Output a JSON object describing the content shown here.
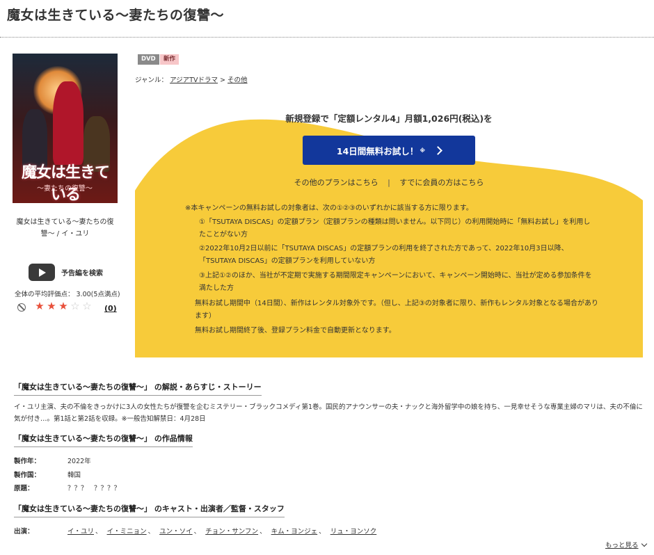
{
  "page": {
    "title": "魔女は生きている〜妻たちの復讐〜"
  },
  "product": {
    "poster_title": "魔女は生きている",
    "poster_subtitle": "〜妻たちの復讐〜",
    "caption": "魔女は生きている〜妻たちの復讐〜 / イ・ユリ",
    "trailer_label": "予告編を検索",
    "average_rating_text": "全体の平均評価点： 3.00(5点満点)",
    "rating": 3,
    "rating_max": 5,
    "review_count": "(0)",
    "badges": {
      "dvd": "DVD",
      "new": "新作"
    },
    "genre": {
      "label": "ジャンル：",
      "link1": "アジアTVドラマ",
      "separator": ">",
      "link2": "その他"
    }
  },
  "campaign": {
    "headline": "新規登録で「定額レンタル4」月額1,026円(税込)を",
    "cta_label": "14日間無料お試し！",
    "cta_note": "※",
    "other_plans": "その他のプランはこちら",
    "divider": "|",
    "members": "すでに会員の方はこちら",
    "conditions_head": "※本キャンペーンの無料お試しの対象者は、次の①②③のいずれかに該当する方に限ります。",
    "conditions": [
      "①「TSUTAYA DISCAS」の定額プラン（定額プランの種類は問いません。以下同じ）の利用開始時に「無料お試し」を利用したことがない方",
      "②2022年10月2日以前に「TSUTAYA DISCAS」の定額プランの利用を終了された方であって、2022年10月3日以降、「TSUTAYA DISCAS」の定額プランを利用していない方",
      "③上記①②のほか、当社が不定期で実施する期間限定キャンペーンにおいて、キャンペーン開始時に、当社が定める参加条件を満たした方"
    ],
    "notes": [
      "無料お試し期間中（14日間）、新作はレンタル対象外です。（但し、上記③の対象者に限り、新作もレンタル対象となる場合があります）",
      "無料お試し期間終了後、登録プラン料金で自動更新となります。"
    ]
  },
  "sections": {
    "synopsis_head": "「魔女は生きている〜妻たちの復讐〜」 の解説・あらすじ・ストーリー",
    "synopsis_text": "イ・ユリ主演、夫の不倫をきっかけに3人の女性たちが復讐を企むミステリー・ブラックコメディ第1巻。国民的アナウンサーの夫・ナックと海外留学中の娘を持ち、一見幸せそうな専業主婦のマリは、夫の不倫に気が付き…。第1話と第2話を収録。※一般告知解禁日：4月28日",
    "info_head": "「魔女は生きている〜妻たちの復讐〜」 の作品情報",
    "info": [
      {
        "label": "製作年：",
        "value": "2022年"
      },
      {
        "label": "製作国：",
        "value": "韓国"
      },
      {
        "label": "原題：",
        "value": "？？？　？？？？"
      }
    ],
    "cast_head": "「魔女は生きている〜妻たちの復讐〜」 のキャスト・出演者／監督・スタッフ",
    "cast_label": "出演：",
    "cast": [
      "イ・ユリ",
      "イ・ミニョン",
      "ユン・ソイ",
      "チョン・サンフン",
      "キム・ヨンジェ",
      "リュ・ヨンソク"
    ],
    "cast_separator": "、",
    "more": "もっと見る"
  }
}
